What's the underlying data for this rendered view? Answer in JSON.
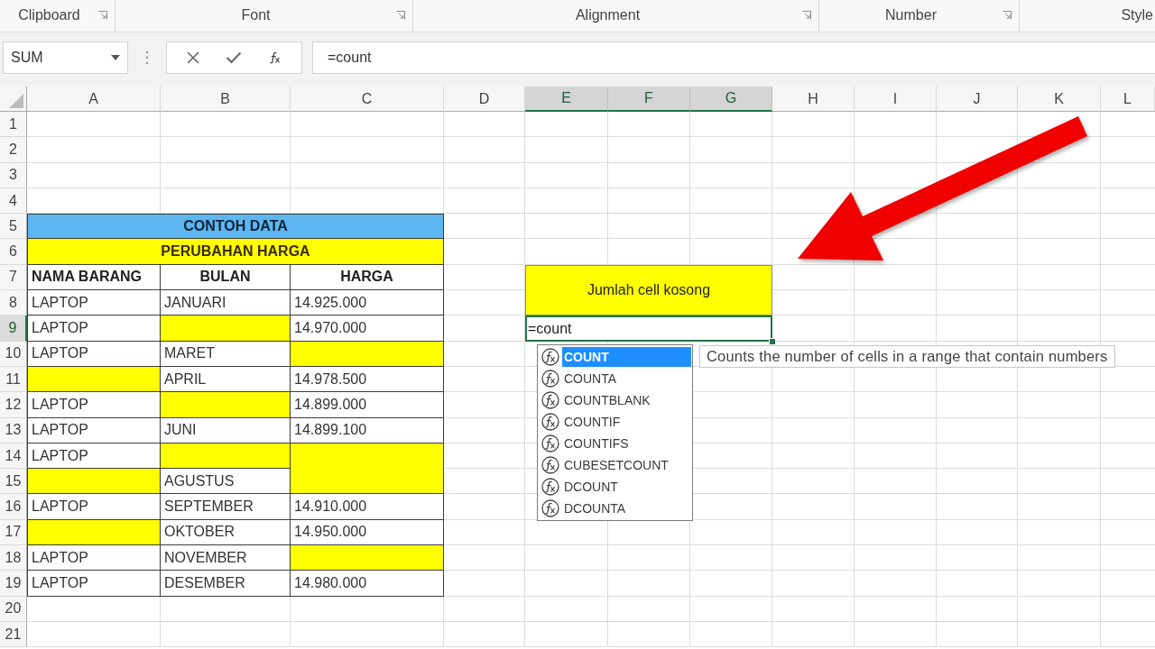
{
  "ribbon": {
    "groups": [
      {
        "label": "Clipboard",
        "launcher": true
      },
      {
        "label": "Font",
        "launcher": true
      },
      {
        "label": "Alignment",
        "launcher": true
      },
      {
        "label": "Number",
        "launcher": true
      },
      {
        "label": "Style",
        "launcher": false
      }
    ]
  },
  "formula_bar": {
    "name_box": "SUM",
    "formula": "=count"
  },
  "sheet": {
    "columns": [
      {
        "label": "A",
        "selected": false
      },
      {
        "label": "B",
        "selected": false
      },
      {
        "label": "C",
        "selected": false
      },
      {
        "label": "D",
        "selected": false
      },
      {
        "label": "E",
        "selected": true
      },
      {
        "label": "F",
        "selected": true
      },
      {
        "label": "G",
        "selected": true
      },
      {
        "label": "H",
        "selected": false
      },
      {
        "label": "I",
        "selected": false
      },
      {
        "label": "J",
        "selected": false
      },
      {
        "label": "K",
        "selected": false
      },
      {
        "label": "L",
        "selected": false
      }
    ],
    "rows": [
      {
        "label": "1",
        "selected": false
      },
      {
        "label": "2",
        "selected": false
      },
      {
        "label": "3",
        "selected": false
      },
      {
        "label": "4",
        "selected": false
      },
      {
        "label": "5",
        "selected": false
      },
      {
        "label": "6",
        "selected": false
      },
      {
        "label": "7",
        "selected": false
      },
      {
        "label": "8",
        "selected": false
      },
      {
        "label": "9",
        "selected": true
      },
      {
        "label": "10",
        "selected": false
      },
      {
        "label": "11",
        "selected": false
      },
      {
        "label": "12",
        "selected": false
      },
      {
        "label": "13",
        "selected": false
      },
      {
        "label": "14",
        "selected": false
      },
      {
        "label": "15",
        "selected": false
      },
      {
        "label": "16",
        "selected": false
      },
      {
        "label": "17",
        "selected": false
      },
      {
        "label": "18",
        "selected": false
      },
      {
        "label": "19",
        "selected": false
      },
      {
        "label": "20",
        "selected": false
      },
      {
        "label": "21",
        "selected": false
      }
    ]
  },
  "table": {
    "title": "CONTOH DATA",
    "subtitle": "PERUBAHAN HARGA",
    "headers": [
      "NAMA BARANG",
      "BULAN",
      "HARGA"
    ],
    "rows": [
      [
        {
          "text": "LAPTOP",
          "highlighted": false
        },
        {
          "text": "JANUARI",
          "highlighted": false
        },
        {
          "text": "14.925.000",
          "highlighted": false
        }
      ],
      [
        {
          "text": "LAPTOP",
          "highlighted": false
        },
        {
          "highlighted": true
        },
        {
          "text": "14.970.000",
          "highlighted": false
        }
      ],
      [
        {
          "text": "LAPTOP",
          "highlighted": false
        },
        {
          "text": "MARET",
          "highlighted": false
        },
        {
          "highlighted": true
        }
      ],
      [
        {
          "highlighted": true
        },
        {
          "text": "APRIL",
          "highlighted": false
        },
        {
          "text": "14.978.500",
          "highlighted": false
        }
      ],
      [
        {
          "text": "LAPTOP",
          "highlighted": false
        },
        {
          "highlighted": true
        },
        {
          "text": "14.899.000",
          "highlighted": false
        }
      ],
      [
        {
          "text": "LAPTOP",
          "highlighted": false
        },
        {
          "text": "JUNI",
          "highlighted": false
        },
        {
          "text": "14.899.100",
          "highlighted": false
        }
      ],
      [
        {
          "text": "LAPTOP",
          "highlighted": false
        },
        {
          "highlighted": true
        },
        {
          "highlighted": true,
          "merged_down": true
        }
      ],
      [
        {
          "highlighted": true
        },
        {
          "text": "AGUSTUS",
          "highlighted": false
        }
      ],
      [
        {
          "text": "LAPTOP",
          "highlighted": false
        },
        {
          "text": "SEPTEMBER",
          "highlighted": false
        },
        {
          "text": "14.910.000",
          "highlighted": false
        }
      ],
      [
        {
          "highlighted": true
        },
        {
          "text": "OKTOBER",
          "highlighted": false
        },
        {
          "text": "14.950.000",
          "highlighted": false
        }
      ],
      [
        {
          "text": "LAPTOP",
          "highlighted": false
        },
        {
          "text": "NOVEMBER",
          "highlighted": false
        },
        {
          "highlighted": true
        }
      ],
      [
        {
          "text": "LAPTOP",
          "highlighted": false
        },
        {
          "text": "DESEMBER",
          "highlighted": false
        },
        {
          "text": "14.980.000",
          "highlighted": false
        }
      ]
    ]
  },
  "label_cell": "Jumlah cell kosong",
  "active_cell": "=count",
  "autocomplete": {
    "items": [
      {
        "name": "COUNT",
        "selected": true
      },
      {
        "name": "COUNTA",
        "selected": false
      },
      {
        "name": "COUNTBLANK",
        "selected": false
      },
      {
        "name": "COUNTIF",
        "selected": false
      },
      {
        "name": "COUNTIFS",
        "selected": false
      },
      {
        "name": "CUBESETCOUNT",
        "selected": false
      },
      {
        "name": "DCOUNT",
        "selected": false
      },
      {
        "name": "DCOUNTA",
        "selected": false
      }
    ],
    "tooltip": "Counts the number of cells in a range that contain numbers"
  }
}
